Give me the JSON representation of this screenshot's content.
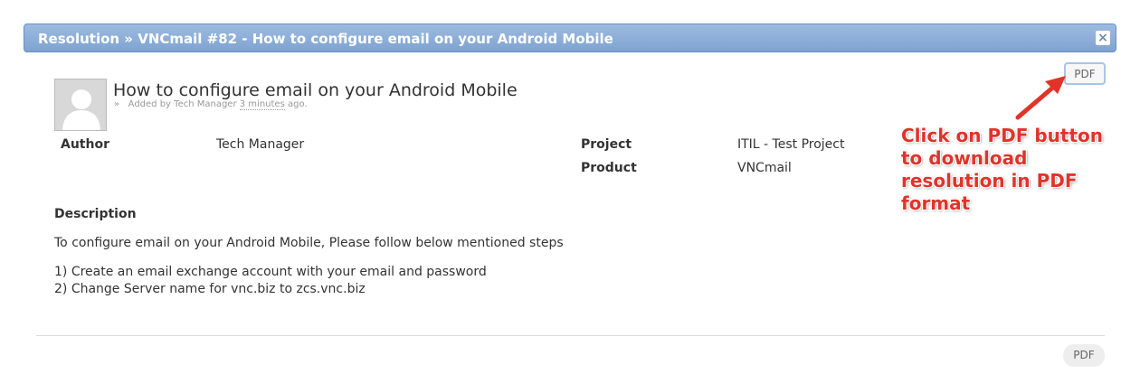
{
  "window": {
    "title": "Resolution » VNCmail #82 - How to configure email on your Android Mobile",
    "close_icon": "close-icon"
  },
  "resolution": {
    "title": "How to configure email on your Android Mobile",
    "meta_prefix": "»",
    "meta_added_by": "Added by Tech Manager",
    "meta_time": "3 minutes",
    "meta_suffix": "ago."
  },
  "pdf_button_label": "PDF",
  "fields": {
    "author_label": "Author",
    "author_value": "Tech Manager",
    "project_label": "Project",
    "project_value": "ITIL - Test Project",
    "product_label": "Product",
    "product_value": "VNCmail"
  },
  "description": {
    "heading": "Description",
    "intro": "To configure email on your Android Mobile, Please follow below mentioned steps",
    "steps": [
      "1) Create an email exchange account with your email and password",
      "2) Change Server name for vnc.biz to zcs.vnc.biz"
    ]
  },
  "annotation": {
    "text": "Click on PDF button to download resolution in PDF format",
    "color": "#e0342a"
  },
  "colors": {
    "titlebar": "#8cafda",
    "pdf_highlight_border": "#aac4e6"
  }
}
